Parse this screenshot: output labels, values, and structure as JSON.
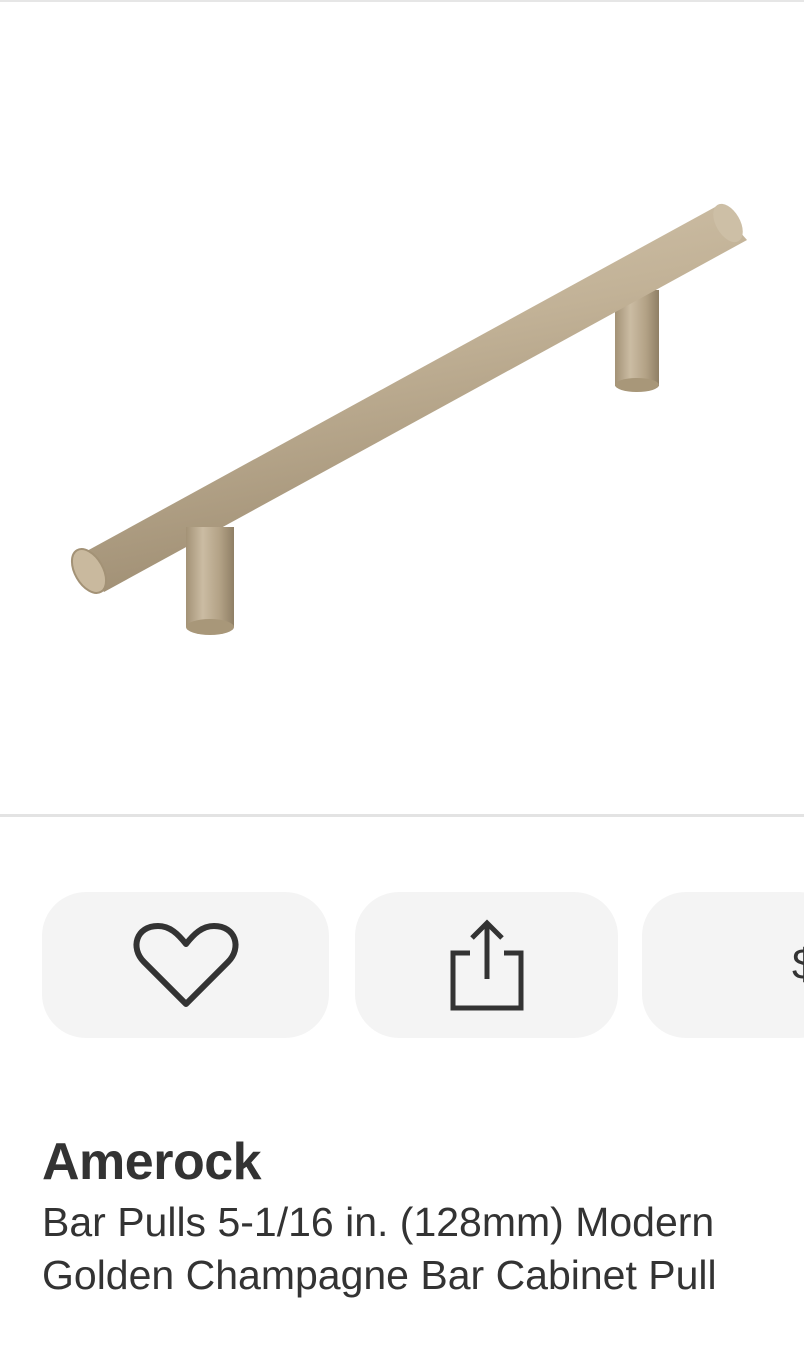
{
  "product": {
    "image_alt": "Amerock golden champagne bar cabinet pull",
    "brand": "Amerock",
    "title": "Bar Pulls 5-1/16 in. (128mm) Modern Golden Champagne Bar Cabinet Pull"
  },
  "actions": [
    {
      "name": "favorite",
      "icon": "heart-icon"
    },
    {
      "name": "share",
      "icon": "share-icon"
    },
    {
      "name": "more",
      "icon": "partial-glyph",
      "glyph": "$"
    }
  ],
  "colors": {
    "button_bg": "#f4f4f4",
    "icon": "#333333",
    "text": "#333333",
    "pull_metal": "#bfae94",
    "divider": "#e3e3e3"
  }
}
